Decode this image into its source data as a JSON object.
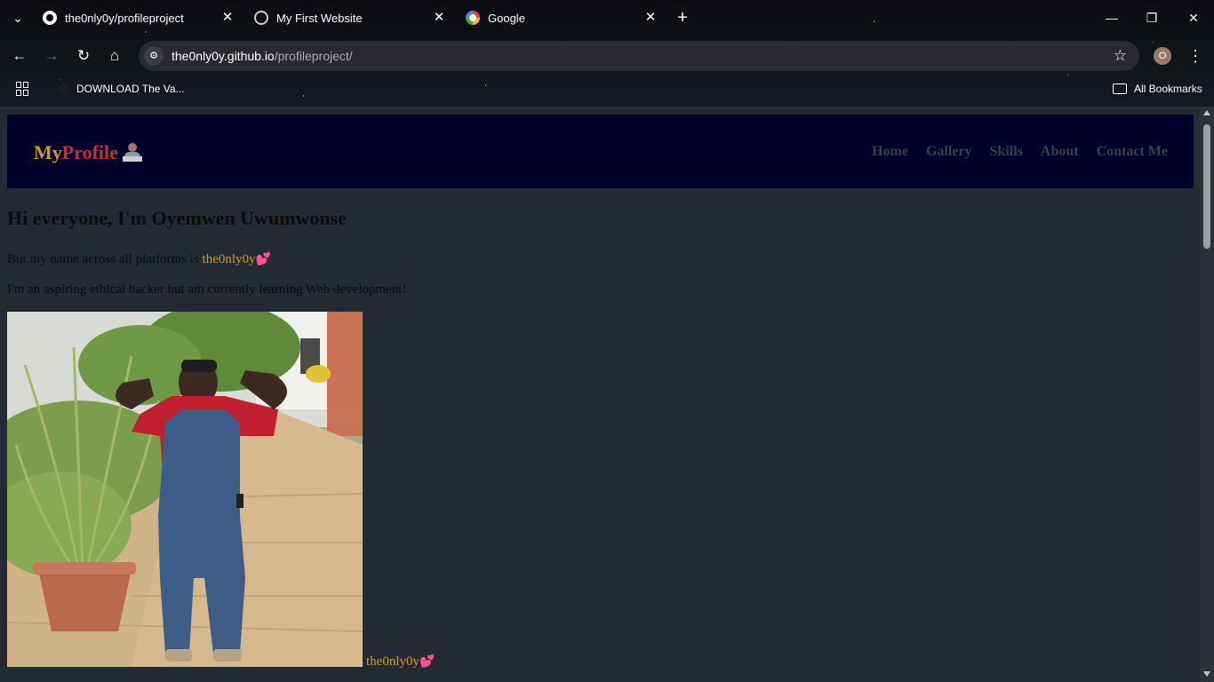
{
  "browser": {
    "tabs": [
      {
        "title": "the0nly0y/profileproject",
        "icon": "github-icon"
      },
      {
        "title": "My First Website",
        "icon": "globe-icon"
      },
      {
        "title": "Google",
        "icon": "google-icon"
      }
    ],
    "url_host": "the0nly0y.github.io",
    "url_path": "/profileproject/",
    "profile_initial": "O",
    "bookmarks": [
      {
        "label": "DOWNLOAD The Va..."
      }
    ],
    "all_bookmarks_label": "All Bookmarks"
  },
  "site": {
    "brand_my": "My",
    "brand_profile": "Profile",
    "brand_icon": "technologist-emoji",
    "nav": [
      {
        "label": "Home"
      },
      {
        "label": "Gallery"
      },
      {
        "label": "Skills"
      },
      {
        "label": "About"
      },
      {
        "label": "Contact Me"
      }
    ],
    "heading": "Hi everyone, I'm Oyemwen Uwumwonse",
    "intro_prefix": "But my name across all platforms is",
    "handle": "the0nly0y",
    "heart": "💕",
    "description": "I'm an aspiring ethical hacker but am currently learning Web development!",
    "photo_alt": "Profile photo",
    "caption_handle": "the0nly0y",
    "caption_heart": "💕"
  },
  "colors": {
    "page_bg": "#232a31",
    "nav_bg": "#01002b",
    "brand_my": "#d29b2a",
    "brand_profile": "#c0303b",
    "handle": "#d9991d"
  }
}
